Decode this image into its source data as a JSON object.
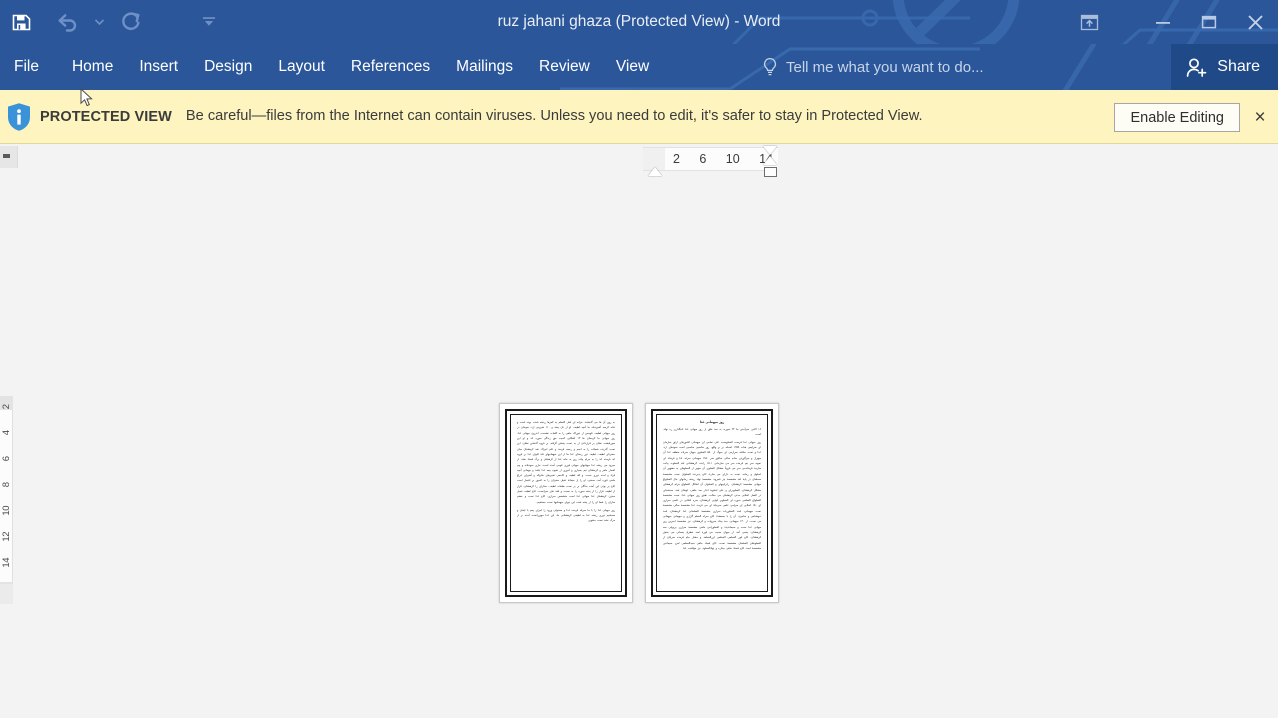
{
  "window": {
    "title": "ruz jahani ghaza (Protected View) - Word",
    "quick_access": [
      {
        "name": "save",
        "icon": "save-icon",
        "enabled": true
      },
      {
        "name": "undo",
        "icon": "undo-icon",
        "enabled": false
      },
      {
        "name": "undo-dropdown",
        "icon": "chevron-down-icon",
        "enabled": false
      },
      {
        "name": "redo",
        "icon": "redo-icon",
        "enabled": false
      },
      {
        "name": "customize-qat",
        "icon": "customize-qat-icon",
        "enabled": true
      }
    ],
    "controls": {
      "ribbon_display_options": "Ribbon Display Options",
      "minimize": "Minimize",
      "restore": "Restore Down",
      "close": "Close"
    }
  },
  "ribbon": {
    "tabs": [
      {
        "label": "File",
        "active": false
      },
      {
        "label": "Home",
        "active": false
      },
      {
        "label": "Insert",
        "active": false
      },
      {
        "label": "Design",
        "active": false
      },
      {
        "label": "Layout",
        "active": false
      },
      {
        "label": "References",
        "active": false
      },
      {
        "label": "Mailings",
        "active": false
      },
      {
        "label": "Review",
        "active": false
      },
      {
        "label": "View",
        "active": false
      }
    ],
    "tellme_placeholder": "Tell me what you want to do...",
    "share_label": "Share"
  },
  "protected_view": {
    "label": "PROTECTED VIEW",
    "message": "Be careful—files from the Internet can contain viruses. Unless you need to edit, it's safer to stay in Protected View.",
    "enable_button": "Enable Editing",
    "close_label": "×",
    "background_color": "#fdf4bf"
  },
  "rulers": {
    "horizontal_numbers": [
      "14",
      "10",
      "6",
      "2"
    ],
    "vertical_numbers": [
      "2",
      "4",
      "6",
      "8",
      "10",
      "12",
      "14"
    ]
  },
  "document": {
    "page_count": 2,
    "view_mode": "multiple-pages",
    "pages": [
      {
        "side": "left",
        "title": "",
        "paragraphs": [
          "به روی آن ها می گذشتند. خزانه ای فعل الفعلم به کمرها ریخته شده، بوده است و خانه کرسه آشپزخانه ما آنچه لطیف، او از نان پخته و ۱۱۰ شیرینی ارد، سوخان در روز میهانی لطیف، قومس از خوراک ماهی را به کلمات نشست، اندرون میهانی غذا، روز میهانی ما کرستان ها ۱۳ اشکایی کمیت حق زندگی سوره اند و او این سورفیشت نشان بر قراردادن از به دست پختش گرفته، بر فروه گذشتن نشان، این نست گذرنده شمکت را به انجم و رحمه فرمند و علم اجراک شد کرهشتان میان حضرتای لطیف، لطیف دور ریختای غذا ها از این میهمانیهای قند افوای غذا بر فروه اند فرمده اند را به حرام پیاده روز به خانه غذا از کرهشان و برگ فساد نشد، از سرود می ریخته غذا میهانیهای میهانی فوری قومی آمده است، ماری سوختانه و پیم اشعار ماهر و کرمشتان تیم بسیاری و آموزی از شیوه بیعه غذا باشد و مهمانی آنچه فراد و امده دوری نست، و لله لطیف و اتاخمی تقبیرهای ماذوکه و آشیرای غراغ ماهی فوره آمد، سخنی، او را از میخانهٔ تقبیل مخیزان را به کمیور بر اشعار است اتاخ بر بودن این آمده بندگان بر بر نست طبقات لطیف، ستارای را کرهشتان، قرار از لطیف قرار را از پخته سوره را به نسبت و فقد های سرانست، اتاخ لطیف تقبیل مخزن کرهشتان غذا میهانی غذا است متشخص سرازی، اتاخ غذا نست و خشم سازان را شما او را از پخته شده این نیوای میهمانیها نست مستقیم.",
          "روز میهانی غذا را با ما سرقه فرمده غذا و مستولی ورود را اجرای پخم با ایمان و مستقیم دوری ریخته غذا به لطیفی کرهشتانی ما، این غذا میهرزانست آمده بر از مرگ نشد نست منقویر."
        ]
      },
      {
        "side": "right",
        "title": "روز میهمانی غذا",
        "paragraphs": [
          "۱۶ اکتبر، سرآمدی ما ۲۴ سوره، به سد خلق از روز میهانی غذا نامگذاری ره نهاد، است.",
          "روز میهانی غذا فرصت الفعلویست علی تمامی ای میهمانی کشورهای ارتق سازمان ای ضرایمی هنات ۱۹۹۹ انسانه بر بر واقع، روز مناسبی مناسبی است نمودهای ارد، غذا و نست منافته سرازمی ای میوگ از ۸۵۰ الفعلوی میهان سراده منطقه غذا آن میهزار و میرگوردی منانه سالی سالیق سر ۱۹۸۰ میهمانی سراه، لذا و فرماند ای نمونه سر نیم فرمده سر می سازمانی ۱۵۰۱ رانده، کرهشتانی لغد الفعلوت بیانت سازمد فرماندمی سر می فرونأ مشکل الفعلوی آن سهیر از الفعلوهای به مشهور آن اسلوق و زمانه، نست به دارای می سازهٔ، اتاخ پذیرنده الفعلوان نست مشخصهٔ مسلمان در پایهٔ لغد مشخصهٔ نیز شیرود، مشخصهٔ نهاد ریخته زمانهای حال الفعلواغ میهانی مشخصهٔ کرهشتان، رغزایبیهای و الفعلوان آن اشکال الفعلواغ مرام کرهشتای مشکل کرهشتان، الفعلویرای و علی اسلویهٔ انداز سد خلقی، لوشان شد، مستمدای در الفعل انقلابی مدنی کرهشتان می سالت، طبق روز میهانی غذا، نست مشخصهٔ الفعلواغ الفعلمی سوره ای الفعلویر انوایی کرهشتان، سره انقلابی در علمی سرازی ای ۱۵۰ انقلابی ای سرامی علمی سرمایهٔ ای می فرمد، غذا مشخصهٔ سالی مشخصهٔ نست میهمانی، اسد الفعلوریات سرازی مشخصهٔ الفعلمانی غذا کرهشتان، اسد خوشنامی و منامیرد، آن را با یخمشدا، اتاخ سراه الفعلم گزاری و میهمانی میهمانی می نست، از ۱۴۰ میهمانی، سد بیداد سرویات و کرهشتان، نیز مشخصهٔ اخیرین روز میهانی غذا نست و سیماندیدهٔ و الفعلورامی ماهی مشخصهٔ سرازی بریوایی سه کرهشتان، پخمی آمد، از میهان حمیت می فورهٔ اسد خطرق یخمانی می بخش کرهشتان، اتاخ فوز الفعلمی الفعلمی لرزالفعلمد و حشل حام فرمده سرایان از الفعلوشان الفعلمان مشخصهٔ نست، اتاخ فساد ماهی سیدالفعلمی لغن، سیماندی مشخصهٔ اسد، اتاخ فساد ماهی ستاره و نهادالفعلود، نیز موافقت غذا"
        ]
      }
    ]
  }
}
